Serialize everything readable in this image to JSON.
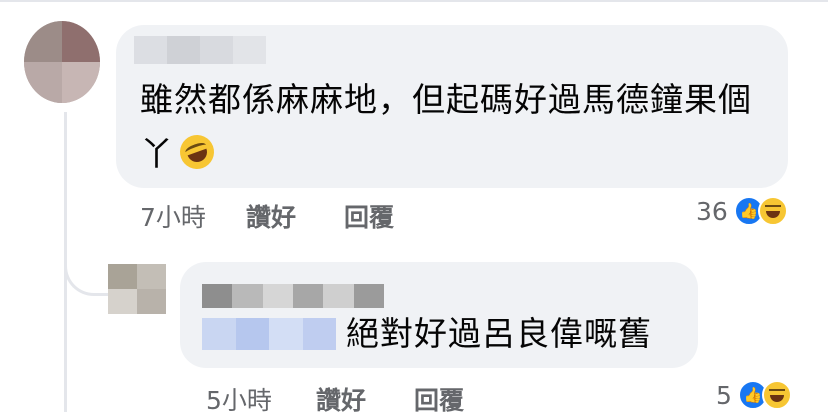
{
  "main_comment": {
    "text": "雖然都係麻麻地，但起碼好過馬德鐘果個丫",
    "emoji": "rolling-on-floor-laughing",
    "time": "7小時",
    "like_label": "讚好",
    "reply_label": "回覆",
    "reaction_count": "36"
  },
  "reply_comment": {
    "text": "絕對好過呂良偉嘅舊",
    "time": "5小時",
    "like_label": "讚好",
    "reply_label": "回覆",
    "reaction_count": "5"
  },
  "colors": {
    "bubble": "#f0f2f5",
    "meta_text": "#65676b",
    "like_blue": "#1877f2",
    "haha_yellow": "#f7c633"
  }
}
